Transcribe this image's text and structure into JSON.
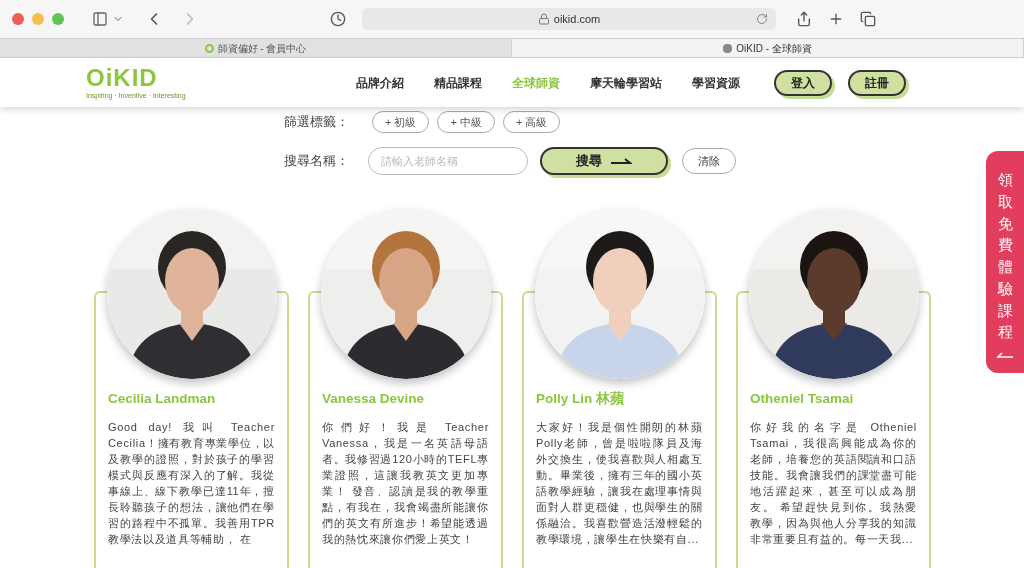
{
  "browser": {
    "url": "oikid.com",
    "tabs": [
      {
        "label": "師資偏好 - 會員中心",
        "selected": false
      },
      {
        "label": "OiKID - 全球師資",
        "selected": true
      }
    ]
  },
  "header": {
    "logo": {
      "name": "OiKID",
      "tagline": "Inspiring · Inventive · Interesting"
    },
    "nav": [
      {
        "label": "品牌介紹",
        "selected": false
      },
      {
        "label": "精品課程",
        "selected": false
      },
      {
        "label": "全球師資",
        "selected": true
      },
      {
        "label": "摩天輪學習站",
        "selected": false
      },
      {
        "label": "學習資源",
        "selected": false
      }
    ],
    "buttons": [
      "登入",
      "註冊"
    ]
  },
  "filter": {
    "label": "篩選標籤：",
    "tags": [
      "+ 初級",
      "+ 中級",
      "+ 高級"
    ]
  },
  "search": {
    "label": "搜尋名稱：",
    "placeholder": "請輸入老師名稱",
    "submit": "搜尋",
    "clear": "清除"
  },
  "teachers": [
    {
      "name": "Cecilia Landman",
      "bio": "Good day! 我叫 Teacher Cecilia！擁有教育專業學位，以及教學的證照，對於孩子的學習模式與反應有深入的了解。我從事線上、線下教學已達11年，擅長聆聽孩子的想法，讓他們在學習的路程中不孤單。我善用TPR教學法以及道具等輔助， 在"
    },
    {
      "name": "Vanessa Devine",
      "bio": "你們好！我是 Teacher Vanessa，我是一名英語母語者。我修習過120小時的TEFL專業證照，這讓我教英文更加專業！ 發音、認讀是我的教學重點，有我在，我會竭盡所能讓你們的英文有所進步！希望能透過我的熱忱來讓你們愛上英文！"
    },
    {
      "name": "Polly Lin 林蘋",
      "bio": "大家好！我是個性開朗的林蘋Polly老師，曾是啦啦隊員及海外交換生，使我喜歡與人相處互動。畢業後，擁有三年的國小英語教學經驗，讓我在處理事情與面對人群更穩健，也與學生的關係融洽。我喜歡營造活潑輕鬆的教學環境，讓學生在快樂有自..."
    },
    {
      "name": "Otheniel Tsamai",
      "bio": "你好我的名字是 Otheniel Tsamai，我很高興能成為你的老師，培養您的英語閱讀和口語技能。我會讓我們的課堂盡可能地活躍起來，甚至可以成為朋友。 希望趕快見到你。我熱愛教學，因為與他人分享我的知識非常重要且有益的。每一天我..."
    }
  ],
  "side_button": {
    "label": "領取免費體驗課程"
  }
}
